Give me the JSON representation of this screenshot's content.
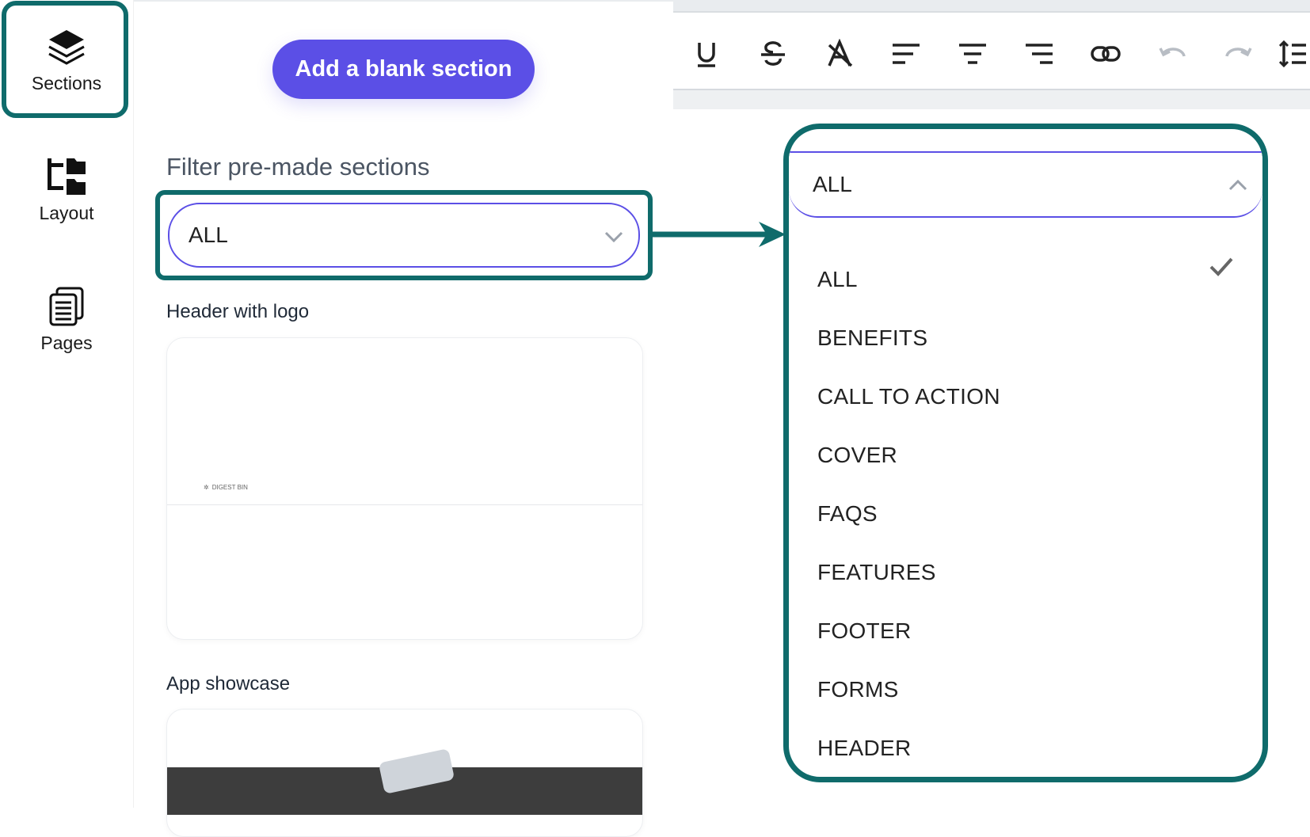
{
  "rail": {
    "sections": "Sections",
    "layout": "Layout",
    "pages": "Pages"
  },
  "panel": {
    "add_button": "Add a blank section",
    "filter_label": "Filter pre-made sections",
    "filter_value": "ALL",
    "cards": [
      {
        "title": "Header with logo",
        "logo_text": "DIGEST BIN"
      },
      {
        "title": "App showcase"
      }
    ]
  },
  "toolbar": {
    "buttons": [
      "underline-icon",
      "strikethrough-icon",
      "clear-format-icon",
      "align-left-icon",
      "align-center-icon",
      "align-right-icon",
      "link-icon",
      "undo-icon",
      "redo-icon",
      "line-height-icon"
    ]
  },
  "dropdown": {
    "selected": "ALL",
    "options": [
      "ALL",
      "BENEFITS",
      "CALL TO ACTION",
      "COVER",
      "FAQS",
      "FEATURES",
      "FOOTER",
      "FORMS",
      "HEADER"
    ]
  },
  "colors": {
    "accent": "#5b4fe6",
    "highlight": "#0f6b6b"
  }
}
